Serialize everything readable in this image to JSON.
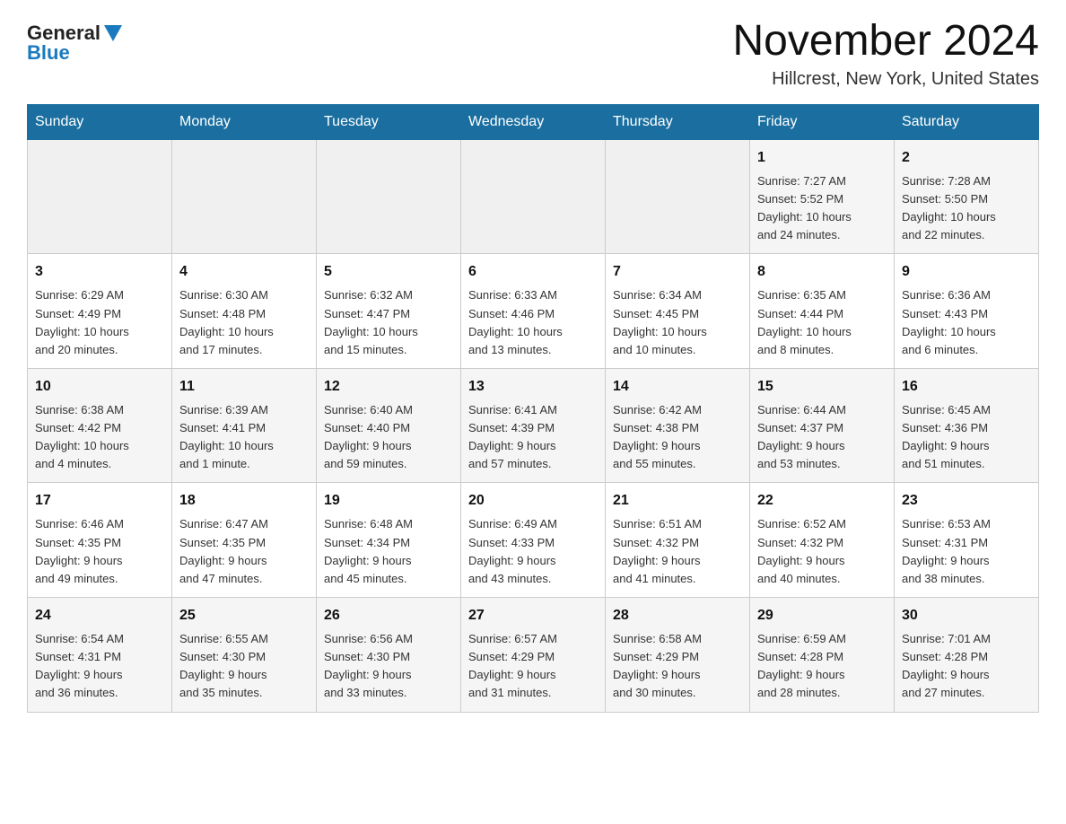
{
  "logo": {
    "general": "General",
    "blue": "Blue"
  },
  "title": "November 2024",
  "location": "Hillcrest, New York, United States",
  "headers": [
    "Sunday",
    "Monday",
    "Tuesday",
    "Wednesday",
    "Thursday",
    "Friday",
    "Saturday"
  ],
  "weeks": [
    [
      {
        "day": "",
        "info": ""
      },
      {
        "day": "",
        "info": ""
      },
      {
        "day": "",
        "info": ""
      },
      {
        "day": "",
        "info": ""
      },
      {
        "day": "",
        "info": ""
      },
      {
        "day": "1",
        "info": "Sunrise: 7:27 AM\nSunset: 5:52 PM\nDaylight: 10 hours\nand 24 minutes."
      },
      {
        "day": "2",
        "info": "Sunrise: 7:28 AM\nSunset: 5:50 PM\nDaylight: 10 hours\nand 22 minutes."
      }
    ],
    [
      {
        "day": "3",
        "info": "Sunrise: 6:29 AM\nSunset: 4:49 PM\nDaylight: 10 hours\nand 20 minutes."
      },
      {
        "day": "4",
        "info": "Sunrise: 6:30 AM\nSunset: 4:48 PM\nDaylight: 10 hours\nand 17 minutes."
      },
      {
        "day": "5",
        "info": "Sunrise: 6:32 AM\nSunset: 4:47 PM\nDaylight: 10 hours\nand 15 minutes."
      },
      {
        "day": "6",
        "info": "Sunrise: 6:33 AM\nSunset: 4:46 PM\nDaylight: 10 hours\nand 13 minutes."
      },
      {
        "day": "7",
        "info": "Sunrise: 6:34 AM\nSunset: 4:45 PM\nDaylight: 10 hours\nand 10 minutes."
      },
      {
        "day": "8",
        "info": "Sunrise: 6:35 AM\nSunset: 4:44 PM\nDaylight: 10 hours\nand 8 minutes."
      },
      {
        "day": "9",
        "info": "Sunrise: 6:36 AM\nSunset: 4:43 PM\nDaylight: 10 hours\nand 6 minutes."
      }
    ],
    [
      {
        "day": "10",
        "info": "Sunrise: 6:38 AM\nSunset: 4:42 PM\nDaylight: 10 hours\nand 4 minutes."
      },
      {
        "day": "11",
        "info": "Sunrise: 6:39 AM\nSunset: 4:41 PM\nDaylight: 10 hours\nand 1 minute."
      },
      {
        "day": "12",
        "info": "Sunrise: 6:40 AM\nSunset: 4:40 PM\nDaylight: 9 hours\nand 59 minutes."
      },
      {
        "day": "13",
        "info": "Sunrise: 6:41 AM\nSunset: 4:39 PM\nDaylight: 9 hours\nand 57 minutes."
      },
      {
        "day": "14",
        "info": "Sunrise: 6:42 AM\nSunset: 4:38 PM\nDaylight: 9 hours\nand 55 minutes."
      },
      {
        "day": "15",
        "info": "Sunrise: 6:44 AM\nSunset: 4:37 PM\nDaylight: 9 hours\nand 53 minutes."
      },
      {
        "day": "16",
        "info": "Sunrise: 6:45 AM\nSunset: 4:36 PM\nDaylight: 9 hours\nand 51 minutes."
      }
    ],
    [
      {
        "day": "17",
        "info": "Sunrise: 6:46 AM\nSunset: 4:35 PM\nDaylight: 9 hours\nand 49 minutes."
      },
      {
        "day": "18",
        "info": "Sunrise: 6:47 AM\nSunset: 4:35 PM\nDaylight: 9 hours\nand 47 minutes."
      },
      {
        "day": "19",
        "info": "Sunrise: 6:48 AM\nSunset: 4:34 PM\nDaylight: 9 hours\nand 45 minutes."
      },
      {
        "day": "20",
        "info": "Sunrise: 6:49 AM\nSunset: 4:33 PM\nDaylight: 9 hours\nand 43 minutes."
      },
      {
        "day": "21",
        "info": "Sunrise: 6:51 AM\nSunset: 4:32 PM\nDaylight: 9 hours\nand 41 minutes."
      },
      {
        "day": "22",
        "info": "Sunrise: 6:52 AM\nSunset: 4:32 PM\nDaylight: 9 hours\nand 40 minutes."
      },
      {
        "day": "23",
        "info": "Sunrise: 6:53 AM\nSunset: 4:31 PM\nDaylight: 9 hours\nand 38 minutes."
      }
    ],
    [
      {
        "day": "24",
        "info": "Sunrise: 6:54 AM\nSunset: 4:31 PM\nDaylight: 9 hours\nand 36 minutes."
      },
      {
        "day": "25",
        "info": "Sunrise: 6:55 AM\nSunset: 4:30 PM\nDaylight: 9 hours\nand 35 minutes."
      },
      {
        "day": "26",
        "info": "Sunrise: 6:56 AM\nSunset: 4:30 PM\nDaylight: 9 hours\nand 33 minutes."
      },
      {
        "day": "27",
        "info": "Sunrise: 6:57 AM\nSunset: 4:29 PM\nDaylight: 9 hours\nand 31 minutes."
      },
      {
        "day": "28",
        "info": "Sunrise: 6:58 AM\nSunset: 4:29 PM\nDaylight: 9 hours\nand 30 minutes."
      },
      {
        "day": "29",
        "info": "Sunrise: 6:59 AM\nSunset: 4:28 PM\nDaylight: 9 hours\nand 28 minutes."
      },
      {
        "day": "30",
        "info": "Sunrise: 7:01 AM\nSunset: 4:28 PM\nDaylight: 9 hours\nand 27 minutes."
      }
    ]
  ]
}
